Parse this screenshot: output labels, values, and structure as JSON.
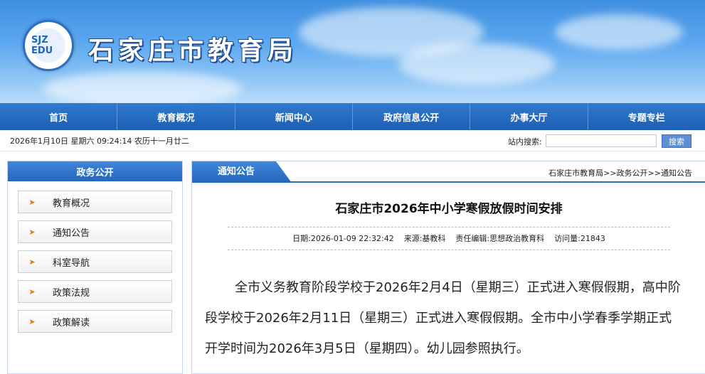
{
  "header": {
    "site_title": "石家庄市教育局",
    "logo_text": "SJZ EDU"
  },
  "nav": [
    {
      "label": "首页"
    },
    {
      "label": "教育概况"
    },
    {
      "label": "新闻中心"
    },
    {
      "label": "政府信息公开"
    },
    {
      "label": "办事大厅"
    },
    {
      "label": "专题专栏"
    }
  ],
  "infobar": {
    "datetime": "2026年1月10日 星期六 09:24:14 农历十一月廿二",
    "search_label": "站内搜索:",
    "search_value": "",
    "search_button": "搜索"
  },
  "sidebar": {
    "title": "政务公开",
    "items": [
      {
        "label": "教育概况"
      },
      {
        "label": "通知公告"
      },
      {
        "label": "科室导航"
      },
      {
        "label": "政策法规"
      },
      {
        "label": "政策解读"
      }
    ],
    "arrow_glyph": "➤"
  },
  "main": {
    "tab_label": "通知公告",
    "breadcrumb": "石家庄市教育局>>政务公开>>通知公告",
    "article": {
      "title": "石家庄市2026年中小学寒假放假时间安排",
      "date": "日期:2026-01-09 22:32:42",
      "source": "来源:基教科",
      "editor": "责任编辑:思想政治教育科",
      "visits": "访问量:21843",
      "body": "全市义务教育阶段学校于2026年2月4日（星期三）正式进入寒假假期，高中阶段学校于2026年2月11日（星期三）正式进入寒假假期。全市中小学春季学期正式开学时间为2026年3月5日（星期四）。幼儿园参照执行。"
    }
  },
  "colors": {
    "nav_blue": "#1d5fb3",
    "accent_orange": "#e07b12",
    "search_button": "#5b8fd6"
  }
}
